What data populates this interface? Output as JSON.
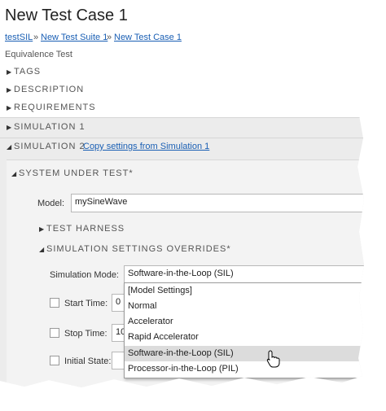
{
  "page": {
    "title": "New Test Case 1"
  },
  "breadcrumb": [
    {
      "label": "testSIL"
    },
    {
      "label": "New Test Suite 1"
    },
    {
      "label": "New Test Case 1"
    }
  ],
  "breadcrumb_separator": "»",
  "test_type": "Equivalence Test",
  "sections": {
    "tags": "TAGS",
    "description": "DESCRIPTION",
    "requirements": "REQUIREMENTS",
    "simulation1": "SIMULATION 1",
    "simulation2": "SIMULATION 2",
    "copy_link": "Copy settings from Simulation 1",
    "system_under_test": "SYSTEM UNDER TEST*",
    "test_harness": "TEST HARNESS",
    "overrides": "SIMULATION SETTINGS OVERRIDES*"
  },
  "model": {
    "label": "Model:",
    "value": "mySineWave"
  },
  "simulation_mode": {
    "label": "Simulation Mode:",
    "selected": "Software-in-the-Loop (SIL)",
    "options": [
      "[Model Settings]",
      "Normal",
      "Accelerator",
      "Rapid Accelerator",
      "Software-in-the-Loop (SIL)",
      "Processor-in-the-Loop (PIL)"
    ],
    "highlighted_index": 4
  },
  "start_time": {
    "label": "Start Time:",
    "value": "0"
  },
  "stop_time": {
    "label": "Stop Time:",
    "value": "10"
  },
  "initial_state": {
    "label": "Initial State:"
  },
  "colors": {
    "link": "#1a5fb4",
    "band": "#ececec",
    "highlight": "#dcdcdc"
  }
}
